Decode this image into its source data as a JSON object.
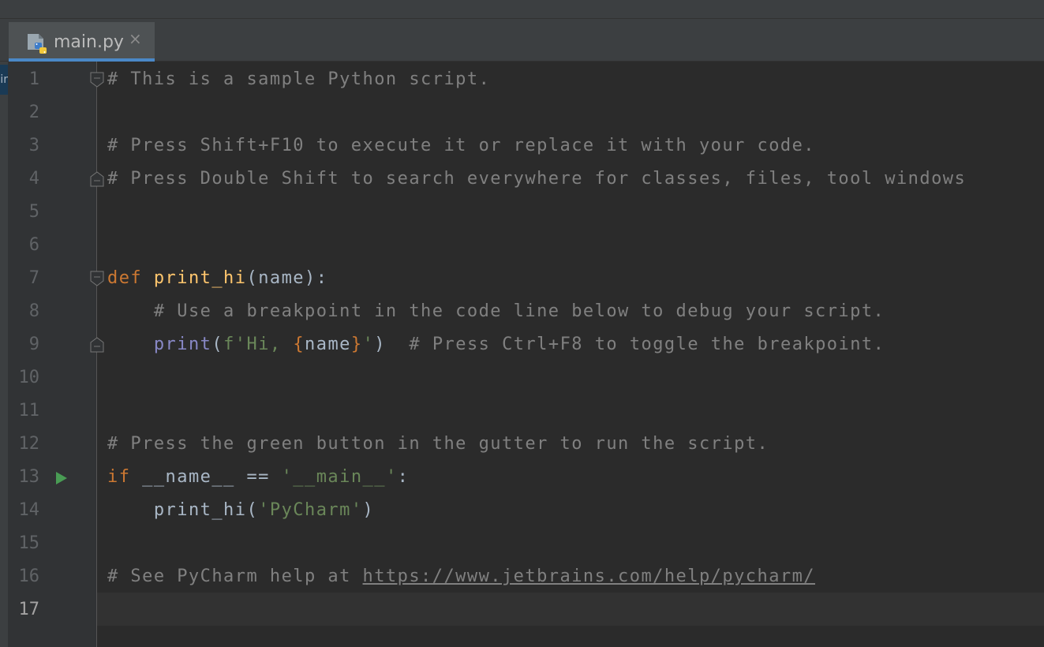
{
  "editor_tab": {
    "filename": "main.py",
    "close_glyph": "×",
    "icon": "python-file-icon"
  },
  "left_strip_label": "ir",
  "current_line": 17,
  "lines": [
    {
      "n": "1",
      "comment": "# This is a sample Python script."
    },
    {
      "n": "2"
    },
    {
      "n": "3",
      "comment": "# Press Shift+F10 to execute it or replace it with your code."
    },
    {
      "n": "4",
      "comment": "# Press Double Shift to search everywhere for classes, files, tool windows"
    },
    {
      "n": "5"
    },
    {
      "n": "6"
    },
    {
      "n": "7",
      "kw": "def ",
      "fn": "print_hi",
      "rest": "(name):"
    },
    {
      "n": "8",
      "indent": "    ",
      "comment": "# Use a breakpoint in the code line below to debug your script."
    },
    {
      "n": "9",
      "indent": "    ",
      "builtin": "print",
      "p1": "(",
      "str1": "f'Hi, ",
      "brace_open": "{",
      "var": "name",
      "brace_close": "}",
      "str2": "'",
      "p2": ")  ",
      "comment": "# Press Ctrl+F8 to toggle the breakpoint."
    },
    {
      "n": "10"
    },
    {
      "n": "11"
    },
    {
      "n": "12",
      "comment": "# Press the green button in the gutter to run the script."
    },
    {
      "n": "13",
      "kw": "if ",
      "rest": "__name__ == ",
      "str": "'__main__'",
      "tail": ":"
    },
    {
      "n": "14",
      "indent": "    ",
      "call": "print_hi(",
      "str": "'PyCharm'",
      "tail": ")"
    },
    {
      "n": "15"
    },
    {
      "n": "16",
      "comment": "# See PyCharm help at ",
      "link": "https://www.jetbrains.com/help/pycharm/"
    },
    {
      "n": "17"
    }
  ],
  "colors": {
    "editor_bg": "#2b2b2b",
    "gutter_bg": "#313335",
    "comment": "#808080",
    "keyword": "#cc7832",
    "function": "#ffc66d",
    "string": "#6a8759",
    "builtin": "#8888c6",
    "text": "#a9b7c6",
    "run_green": "#499c54",
    "tab_underline": "#4a88c7"
  }
}
